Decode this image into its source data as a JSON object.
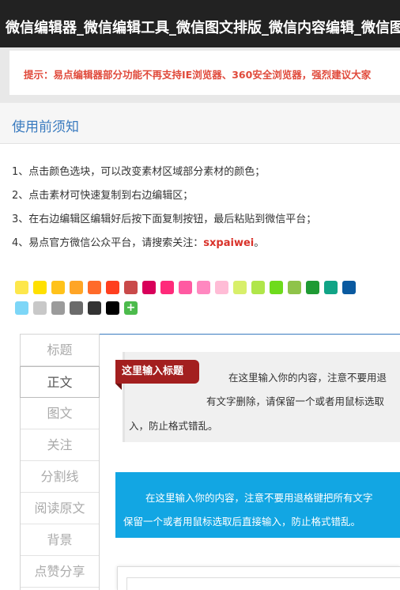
{
  "window": {
    "title": "微信编辑器_微信编辑工具_微信图文排版_微信内容编辑_微信图"
  },
  "notice": {
    "text": "提示：易点编辑器部分功能不再支持IE浏览器、360安全浏览器，强烈建议大家"
  },
  "section": {
    "title": "使用前须知"
  },
  "instructions": [
    "1、点击颜色选块，可以改变素材区域部分素材的颜色；",
    "2、点击素材可快速复制到右边编辑区；",
    "3、在右边编辑区编辑好后按下面复制按钮，最后粘贴到微信平台；",
    "4、易点官方微信公众平台，请搜索关注："
  ],
  "wechat_account": "sxpaiwei",
  "account_suffix": "。",
  "palette": {
    "row1": [
      "#fde74c",
      "#ffe000",
      "#ffc21a",
      "#ffa526",
      "#ff6a2a",
      "#ff3f1f",
      "#c94a4a",
      "#d8005a",
      "#ff2a7a",
      "#ff5aa2",
      "#ff88c0",
      "#ffbcd6",
      "#d8ef6a",
      "#b0e64a",
      "#6edb1c",
      "#8fc34a",
      "#1e9a34",
      "#11a486",
      "#0a5aa0"
    ],
    "row2": [
      "#7dd6f7",
      "#c8c8c8",
      "#9b9b9b",
      "#6b6b6b",
      "#333333",
      "#000000"
    ],
    "add_label": "+"
  },
  "tabs": [
    "标题",
    "正文",
    "图文",
    "关注",
    "分割线",
    "阅读原文",
    "背景",
    "点赞分享"
  ],
  "active_tab": "正文",
  "card1": {
    "title": "这里输入标题",
    "line1": "在这里输入你的内容，注意不要用退",
    "line2": "有文字删除，请保留一个或者用鼠标选取",
    "line3": "入，防止格式错乱。"
  },
  "card2": {
    "line1": "在这里输入你的内容，注意不要用退格键把所有文字",
    "line2": "保留一个或者用鼠标选取后直接输入，防止格式错乱。"
  }
}
